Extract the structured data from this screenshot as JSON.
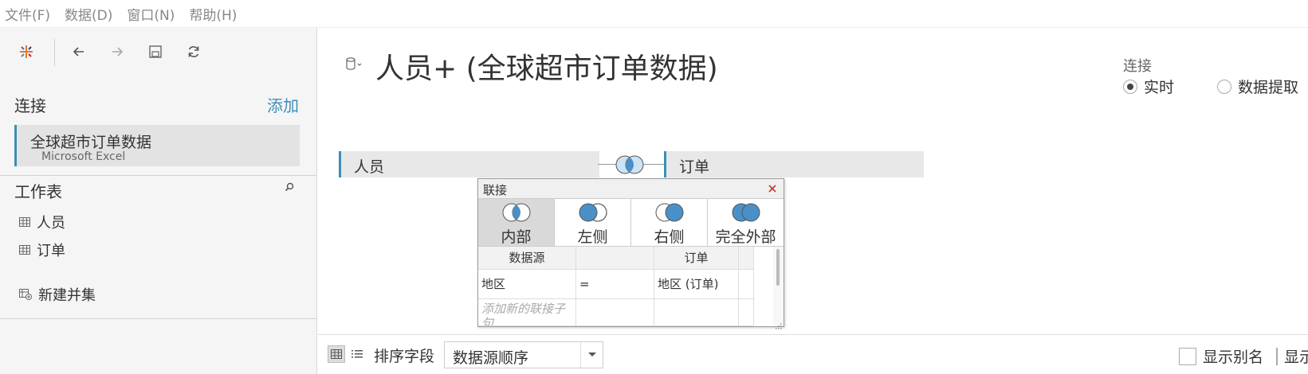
{
  "menu": [
    "文件(F)",
    "数据(D)",
    "窗口(N)",
    "帮助(H)"
  ],
  "left": {
    "connections_title": "连接",
    "add_label": "添加",
    "connection": {
      "name": "全球超市订单数据",
      "type": "Microsoft Excel"
    },
    "sheets_title": "工作表",
    "sheets": [
      "人员",
      "订单"
    ],
    "new_union": "新建并集"
  },
  "main": {
    "title": "人员+ (全球超市订单数据)",
    "connection_mode": {
      "label": "连接",
      "options": [
        {
          "label": "实时",
          "selected": true
        },
        {
          "label": "数据提取",
          "selected": false
        }
      ]
    },
    "left_table": "人员",
    "right_table": "订单"
  },
  "join_dialog": {
    "title": "联接",
    "types": [
      {
        "label": "内部",
        "selected": true
      },
      {
        "label": "左侧",
        "selected": false
      },
      {
        "label": "右侧",
        "selected": false
      },
      {
        "label": "完全外部",
        "selected": false
      }
    ],
    "headers": [
      "数据源",
      "",
      "订单"
    ],
    "clause": {
      "left": "地区",
      "op": "=",
      "right": "地区 (订单)"
    },
    "add_placeholder": "添加新的联接子句"
  },
  "bottom": {
    "sort_label": "排序字段",
    "sort_value": "数据源顺序",
    "show_alias": "显示别名",
    "show_hidden": "显示隐藏字段"
  },
  "colors": {
    "accent": "#3a8fb7",
    "venn_fill": "#4a90c8"
  }
}
